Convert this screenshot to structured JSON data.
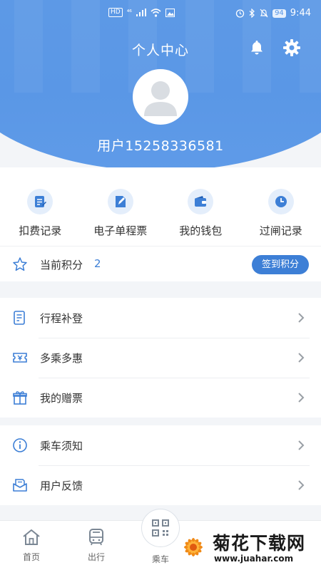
{
  "status_bar": {
    "left_chips": [
      "HD",
      "⁴⁶"
    ],
    "battery": "94",
    "time": "9:44"
  },
  "header": {
    "title": "个人中心",
    "username": "用户15258336581"
  },
  "quick_actions": [
    {
      "label": "扣费记录",
      "icon": "receipt-icon"
    },
    {
      "label": "电子单程票",
      "icon": "ticket-icon"
    },
    {
      "label": "我的钱包",
      "icon": "wallet-icon"
    },
    {
      "label": "过闸记录",
      "icon": "clock-icon"
    }
  ],
  "points": {
    "label": "当前积分",
    "value": "2",
    "button": "签到积分"
  },
  "menu_group_1": [
    {
      "label": "行程补登",
      "icon": "document-icon"
    },
    {
      "label": "多乘多惠",
      "icon": "coupon-icon"
    },
    {
      "label": "我的赠票",
      "icon": "gift-icon"
    }
  ],
  "menu_group_2": [
    {
      "label": "乘车须知",
      "icon": "info-icon"
    },
    {
      "label": "用户反馈",
      "icon": "feedback-icon"
    }
  ],
  "bottom_nav": {
    "home": "首页",
    "travel": "出行",
    "ride": "乘车"
  },
  "watermark": {
    "title": "菊花下载网",
    "url": "www.juahar.com"
  },
  "colors": {
    "header_blue": "#5a97e6",
    "accent": "#3d7fd6",
    "icon_bg": "#e4eefb"
  }
}
